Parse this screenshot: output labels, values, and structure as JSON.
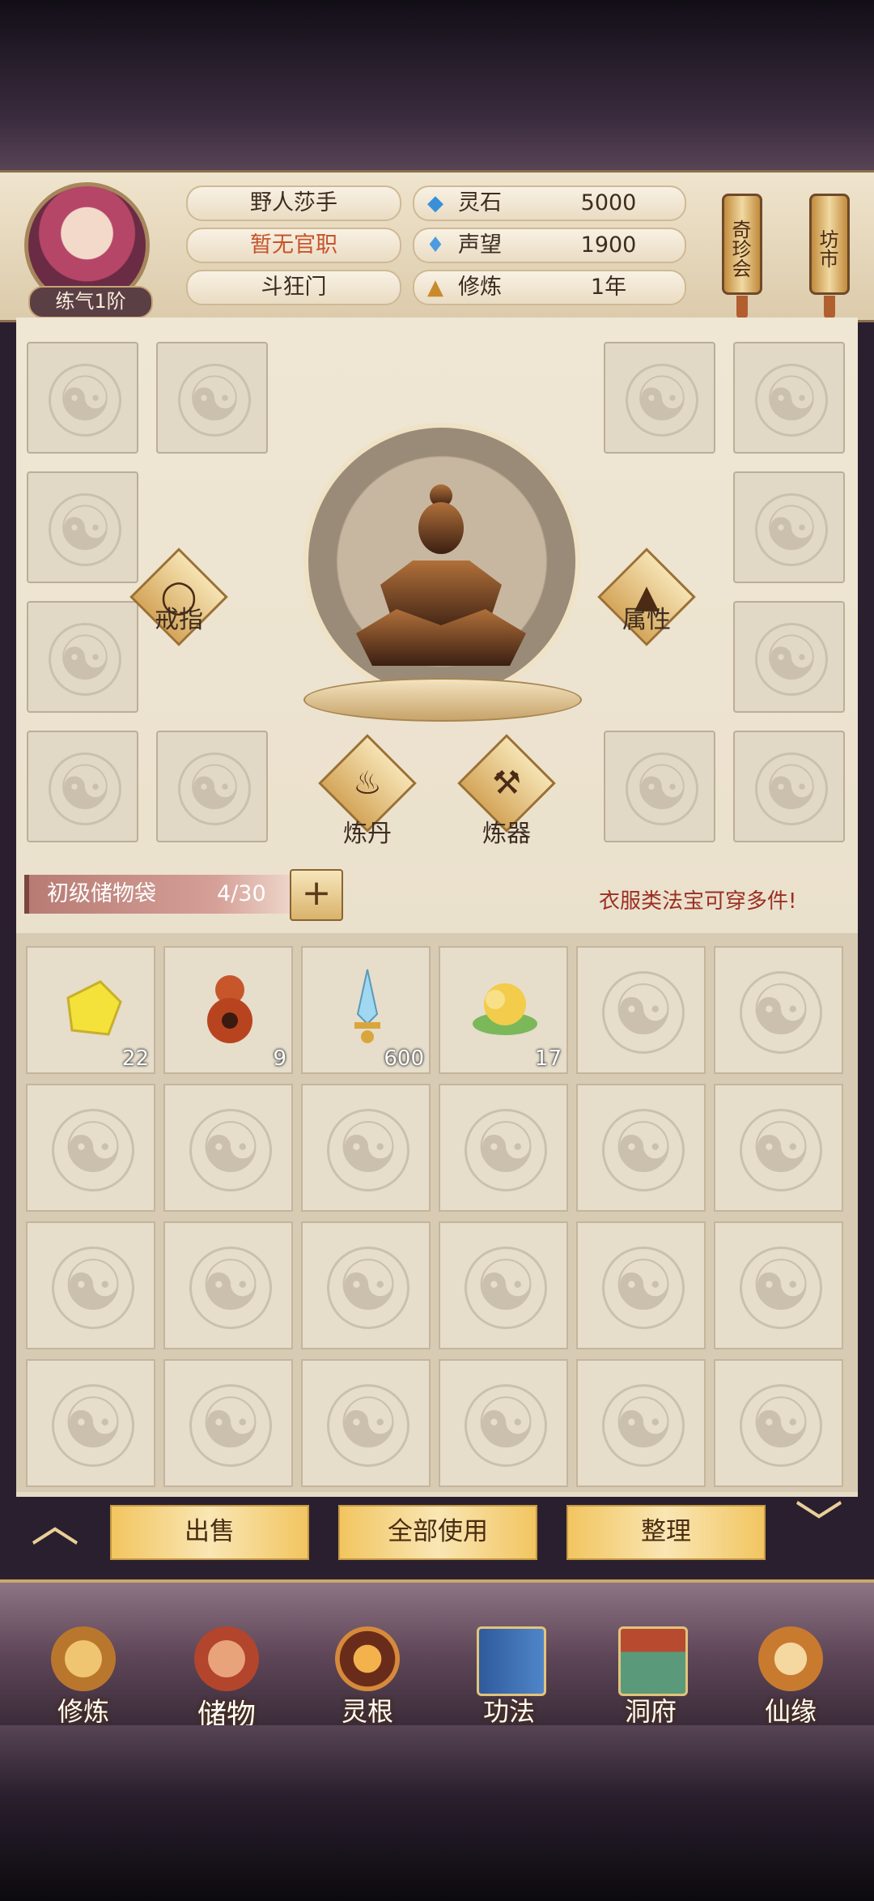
{
  "player": {
    "name": "野人莎手",
    "office": "暂无官职",
    "sect": "斗狂门",
    "realm": "练气1阶"
  },
  "stats": [
    {
      "icon": "spirit-stone-icon",
      "label": "灵石",
      "value": "5000"
    },
    {
      "icon": "prestige-icon",
      "label": "声望",
      "value": "1900"
    },
    {
      "icon": "cultivation-icon",
      "label": "修炼",
      "value": "1年"
    }
  ],
  "shops": {
    "treasure": "奇珍会",
    "market": "坊市"
  },
  "equipment": {
    "ring": "戒指",
    "attributes": "属性",
    "alchemy": "炼丹",
    "forge": "炼器"
  },
  "bag": {
    "name": "初级储物袋",
    "count": "4/30",
    "notice": "衣服类法宝可穿多件!"
  },
  "inventory": [
    {
      "icon": "yellow-stone-icon",
      "count": "22"
    },
    {
      "icon": "gourd-icon",
      "count": "9"
    },
    {
      "icon": "sword-icon",
      "count": "600"
    },
    {
      "icon": "gold-cloud-icon",
      "count": "17"
    }
  ],
  "actions": {
    "sell": "出售",
    "use_all": "全部使用",
    "sort": "整理"
  },
  "nav": [
    {
      "label": "修炼",
      "icon": "meditation-icon"
    },
    {
      "label": "储物",
      "icon": "storage-bag-icon"
    },
    {
      "label": "灵根",
      "icon": "spirit-root-icon"
    },
    {
      "label": "功法",
      "icon": "technique-book-icon"
    },
    {
      "label": "洞府",
      "icon": "cave-mansion-icon"
    },
    {
      "label": "仙缘",
      "icon": "immortal-fate-icon"
    }
  ],
  "colors": {
    "accent_gold": "#f2c560",
    "notice_red": "#9b2f23",
    "office_orange": "#c8542b"
  }
}
